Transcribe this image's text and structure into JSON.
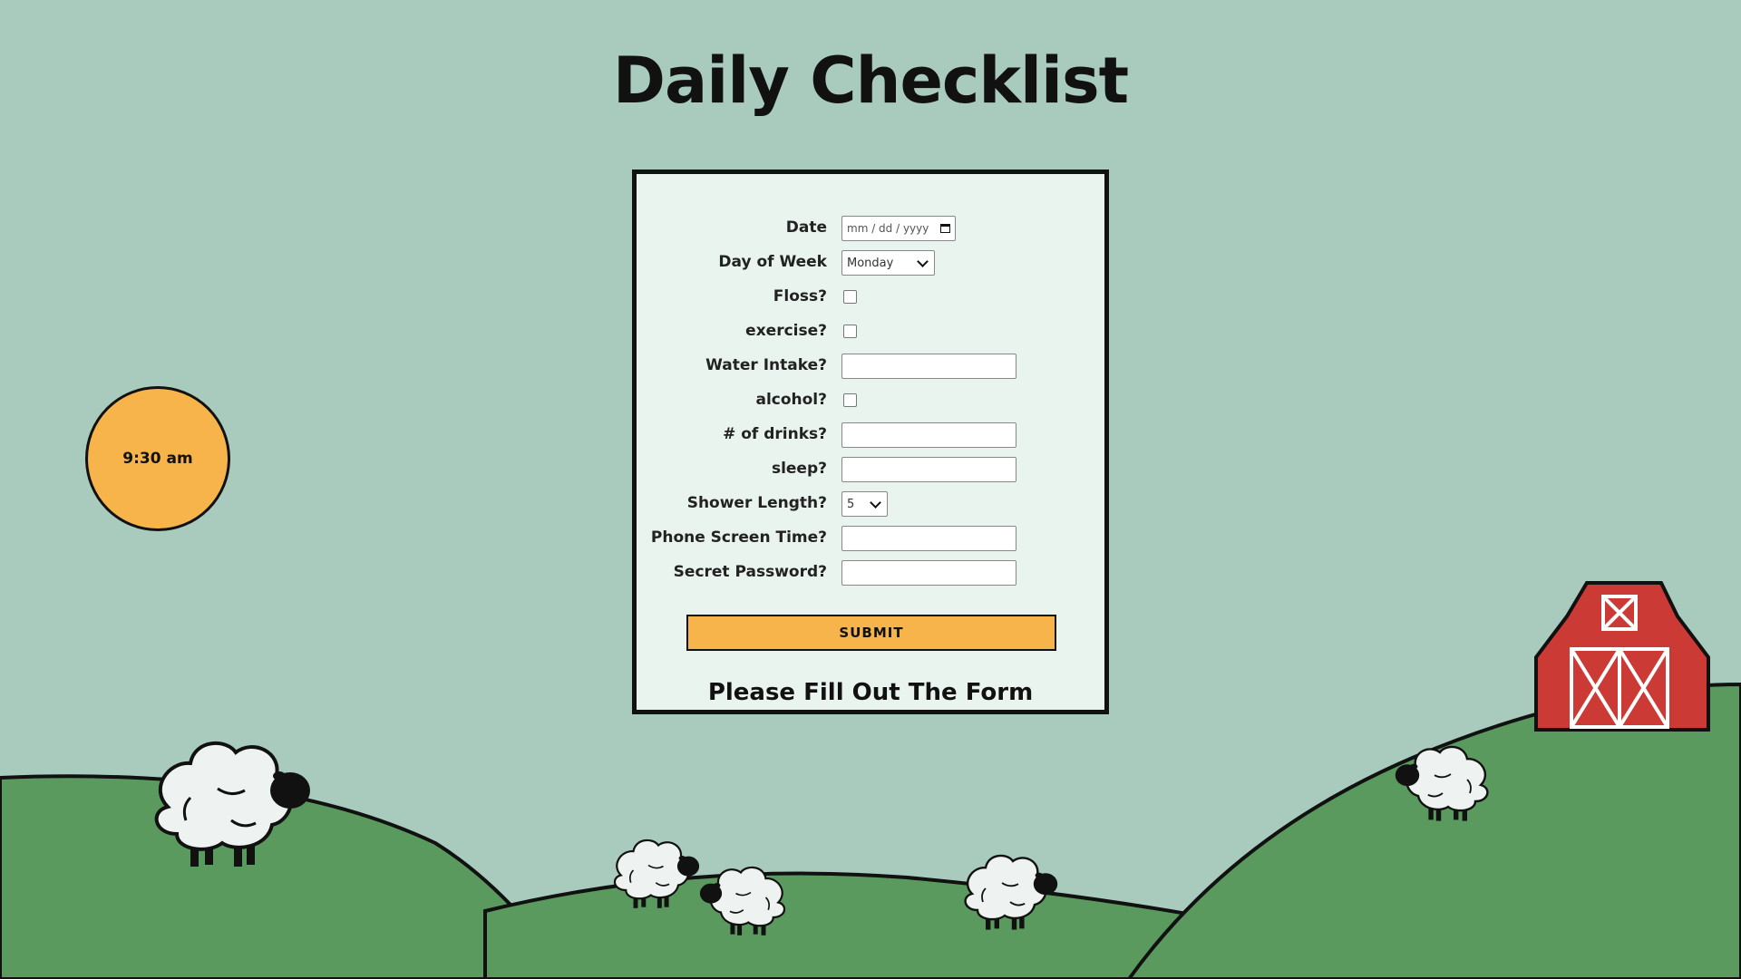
{
  "header": {
    "title": "Daily Checklist"
  },
  "clock": {
    "time": "9:30 am"
  },
  "form": {
    "date": {
      "label": "Date",
      "placeholder": "mm / dd / yyyy"
    },
    "day_of_week": {
      "label": "Day of Week",
      "selected": "Monday"
    },
    "floss": {
      "label": "Floss?",
      "checked": false
    },
    "exercise": {
      "label": "exercise?",
      "checked": false
    },
    "water_intake": {
      "label": "Water Intake?",
      "value": ""
    },
    "alcohol": {
      "label": "alcohol?",
      "checked": false
    },
    "num_drinks": {
      "label": "# of drinks?",
      "value": ""
    },
    "sleep": {
      "label": "sleep?",
      "value": ""
    },
    "shower_length": {
      "label": "Shower Length?",
      "selected": "5"
    },
    "phone_screen_time": {
      "label": "Phone Screen Time?",
      "value": ""
    },
    "secret_password": {
      "label": "Secret Password?",
      "value": ""
    },
    "submit_label": "SUBMIT",
    "status_message": "Please Fill Out The Form"
  },
  "colors": {
    "sky": "#a8cbbd",
    "hill": "#5a9a5e",
    "sun": "#f7b44b",
    "barn": "#cc3a36",
    "form_background": "#e9f4ef",
    "button": "#f7b44b"
  },
  "icons": [
    "calendar-icon",
    "chevron-down-icon",
    "sun-icon",
    "barn-icon",
    "sheep-icon"
  ]
}
